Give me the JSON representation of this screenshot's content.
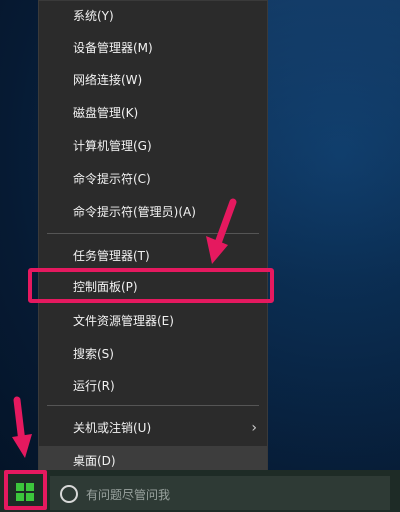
{
  "menu": {
    "items": [
      {
        "label": "系统(Y)"
      },
      {
        "label": "设备管理器(M)"
      },
      {
        "label": "网络连接(W)"
      },
      {
        "label": "磁盘管理(K)"
      },
      {
        "label": "计算机管理(G)"
      },
      {
        "label": "命令提示符(C)"
      },
      {
        "label": "命令提示符(管理员)(A)"
      },
      {
        "label": "任务管理器(T)"
      },
      {
        "label": "控制面板(P)"
      },
      {
        "label": "文件资源管理器(E)"
      },
      {
        "label": "搜索(S)"
      },
      {
        "label": "运行(R)"
      },
      {
        "label": "关机或注销(U)"
      },
      {
        "label": "桌面(D)"
      }
    ]
  },
  "taskbar": {
    "search_placeholder": "有问题尽管问我"
  },
  "icons": {
    "start": "windows-logo-icon",
    "cortana": "cortana-circle-icon",
    "submenu": "chevron-right-icon"
  },
  "colors": {
    "highlight": "#e5195f",
    "menu_bg": "#2b2b2b",
    "start_logo": "#3cc63c"
  }
}
